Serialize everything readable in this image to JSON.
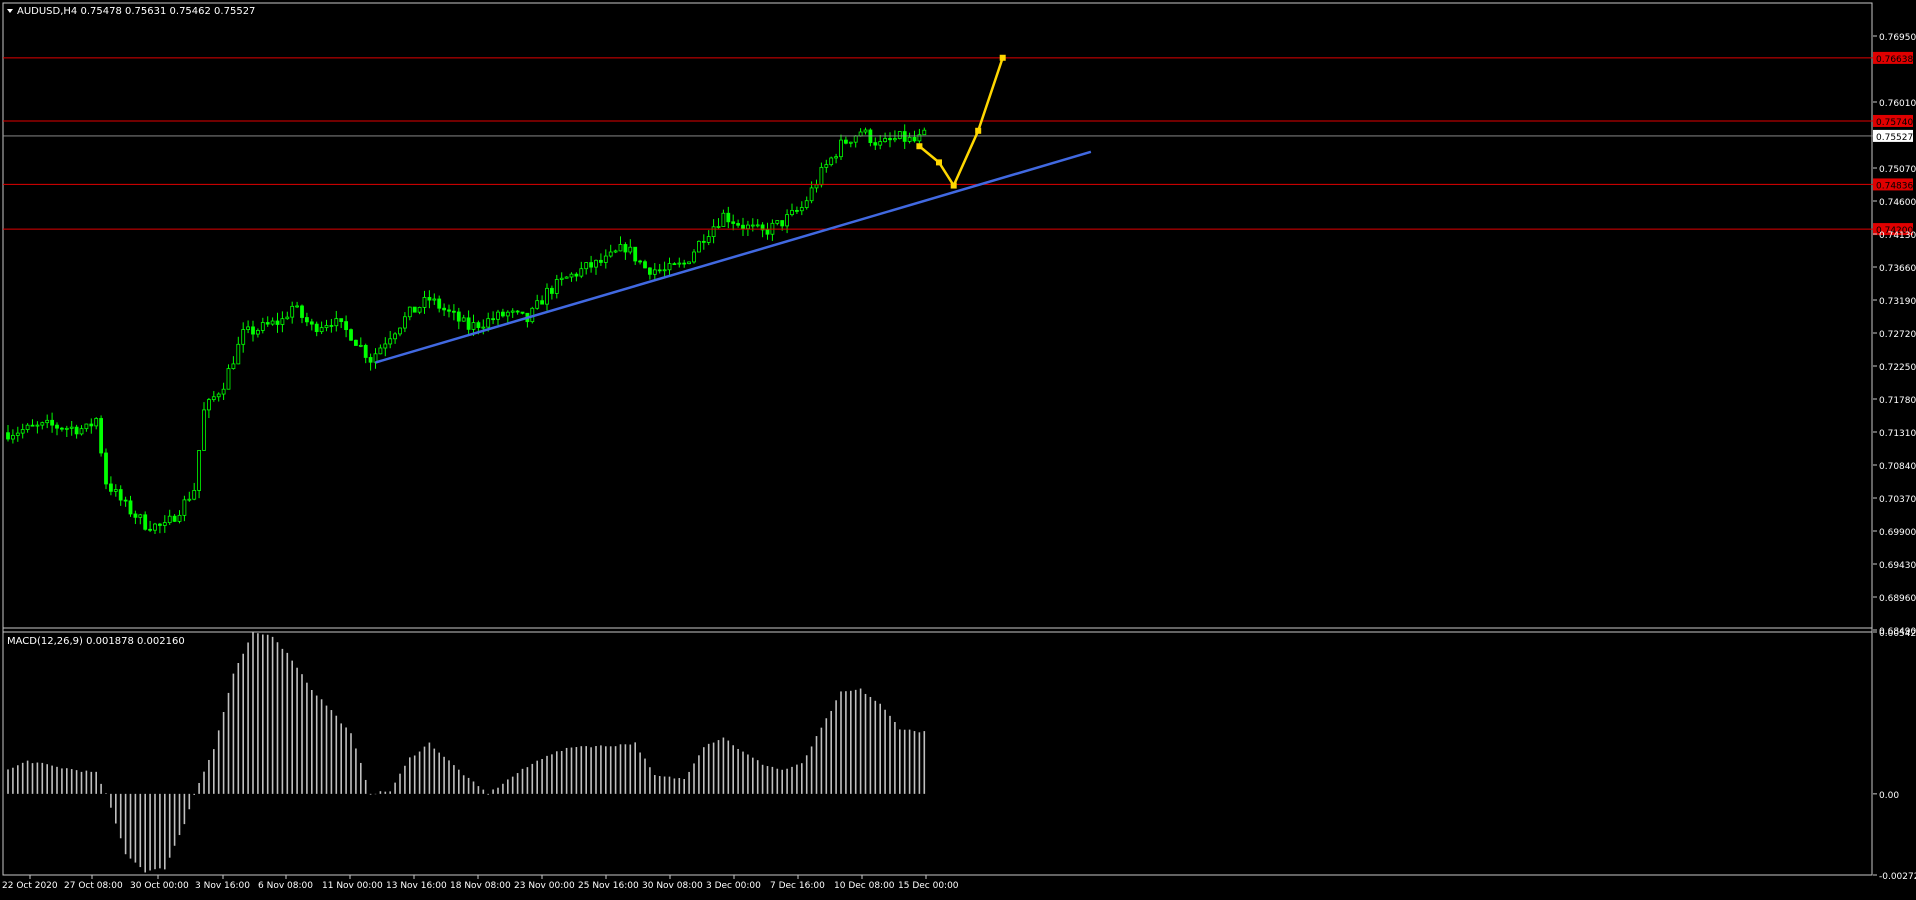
{
  "colors": {
    "background": "#000000",
    "frame": "#c8c8c8",
    "bull_candle": "#00ff00",
    "bear_candle": "#00ff00",
    "level_line": "#e00000",
    "level_tag_fill": "#e00000",
    "trendline": "#4169e1",
    "projection": "#ffd700",
    "macd_bars": "#c0c0c0",
    "axis_text": "#ffffff"
  },
  "main_panel": {
    "header": "AUDUSD,H4  0.75478 0.75631 0.75462 0.75527",
    "menu_icon": "triangle-down-icon"
  },
  "macd_panel": {
    "header": "MACD(12,26,9) 0.001878 0.002160"
  },
  "chart_data": [
    {
      "type": "candlestick",
      "symbol": "AUDUSD",
      "timeframe": "H4",
      "ylim": [
        0.6849,
        0.7742
      ],
      "y_ticks": [
        "0.76950",
        "0.76010",
        "0.75070",
        "0.74600",
        "0.74130",
        "0.73660",
        "0.73190",
        "0.72720",
        "0.72250",
        "0.71780",
        "0.71310",
        "0.70840",
        "0.70370",
        "0.69900",
        "0.69430",
        "0.68960",
        "0.68490"
      ],
      "x_ticks": [
        "22 Oct 2020",
        "27 Oct 08:00",
        "30 Oct 00:00",
        "3 Nov 16:00",
        "6 Nov 08:00",
        "11 Nov 00:00",
        "13 Nov 16:00",
        "18 Nov 08:00",
        "23 Nov 00:00",
        "25 Nov 16:00",
        "30 Nov 08:00",
        "3 Dec 00:00",
        "7 Dec 16:00",
        "10 Dec 08:00",
        "15 Dec 00:00"
      ],
      "bar_count": 188,
      "price_path": [
        [
          0,
          0.713
        ],
        [
          8,
          0.714
        ],
        [
          16,
          0.7135
        ],
        [
          18,
          0.715
        ],
        [
          20,
          0.706
        ],
        [
          24,
          0.7025
        ],
        [
          28,
          0.7
        ],
        [
          32,
          0.6995
        ],
        [
          36,
          0.703
        ],
        [
          38,
          0.705
        ],
        [
          40,
          0.716
        ],
        [
          44,
          0.72
        ],
        [
          48,
          0.727
        ],
        [
          52,
          0.728
        ],
        [
          56,
          0.729
        ],
        [
          58,
          0.731
        ],
        [
          62,
          0.728
        ],
        [
          66,
          0.729
        ],
        [
          70,
          0.727
        ],
        [
          74,
          0.7235
        ],
        [
          78,
          0.727
        ],
        [
          82,
          0.73
        ],
        [
          86,
          0.732
        ],
        [
          90,
          0.73
        ],
        [
          94,
          0.728
        ],
        [
          98,
          0.729
        ],
        [
          102,
          0.73
        ],
        [
          106,
          0.729
        ],
        [
          110,
          0.733
        ],
        [
          114,
          0.735
        ],
        [
          118,
          0.7365
        ],
        [
          122,
          0.7375
        ],
        [
          126,
          0.7395
        ],
        [
          130,
          0.7365
        ],
        [
          134,
          0.736
        ],
        [
          138,
          0.737
        ],
        [
          142,
          0.741
        ],
        [
          146,
          0.744
        ],
        [
          150,
          0.7425
        ],
        [
          154,
          0.7415
        ],
        [
          158,
          0.743
        ],
        [
          162,
          0.745
        ],
        [
          166,
          0.75
        ],
        [
          170,
          0.754
        ],
        [
          174,
          0.756
        ],
        [
          178,
          0.754
        ],
        [
          182,
          0.755
        ],
        [
          185,
          0.7545
        ],
        [
          187,
          0.75527
        ]
      ],
      "current_price": "0.75527",
      "levels": [
        {
          "price": 0.76638,
          "label": "0.76638"
        },
        {
          "price": 0.7574,
          "label": "0.75740"
        },
        {
          "price": 0.74836,
          "label": "0.74836"
        },
        {
          "price": 0.742,
          "label": "0.74200"
        }
      ],
      "trendline": [
        [
          75,
          0.723
        ],
        [
          221,
          0.753
        ]
      ],
      "projection": [
        [
          186,
          0.7538
        ],
        [
          190,
          0.7515
        ],
        [
          193,
          0.7482
        ],
        [
          198,
          0.756
        ],
        [
          203,
          0.7664
        ]
      ]
    },
    {
      "type": "histogram",
      "name": "MACD(12,26,9)",
      "ylim": [
        -0.002721,
        0.005427
      ],
      "y_ticks": [
        "0.005427",
        "0.00",
        "-0.002721"
      ],
      "macd_path": [
        [
          0,
          0.0008
        ],
        [
          4,
          0.0011
        ],
        [
          10,
          0.0009
        ],
        [
          18,
          0.0007
        ],
        [
          20,
          0.0
        ],
        [
          24,
          -0.002
        ],
        [
          28,
          -0.0026
        ],
        [
          32,
          -0.0025
        ],
        [
          36,
          -0.001
        ],
        [
          38,
          0.0
        ],
        [
          42,
          0.0015
        ],
        [
          46,
          0.004
        ],
        [
          50,
          0.0054
        ],
        [
          54,
          0.0053
        ],
        [
          58,
          0.0045
        ],
        [
          62,
          0.0035
        ],
        [
          66,
          0.0028
        ],
        [
          70,
          0.002
        ],
        [
          74,
          0.0
        ],
        [
          78,
          0.0001
        ],
        [
          82,
          0.0012
        ],
        [
          86,
          0.0017
        ],
        [
          90,
          0.0011
        ],
        [
          94,
          0.0005
        ],
        [
          98,
          0.0
        ],
        [
          104,
          0.0007
        ],
        [
          110,
          0.0013
        ],
        [
          116,
          0.0016
        ],
        [
          122,
          0.0016
        ],
        [
          128,
          0.0017
        ],
        [
          132,
          0.0006
        ],
        [
          138,
          0.0005
        ],
        [
          142,
          0.0016
        ],
        [
          146,
          0.0019
        ],
        [
          150,
          0.0014
        ],
        [
          154,
          0.001
        ],
        [
          158,
          0.0008
        ],
        [
          162,
          0.001
        ],
        [
          166,
          0.0022
        ],
        [
          170,
          0.0034
        ],
        [
          174,
          0.0035
        ],
        [
          178,
          0.003
        ],
        [
          182,
          0.0022
        ],
        [
          185,
          0.0021
        ],
        [
          187,
          0.0021
        ]
      ]
    }
  ]
}
